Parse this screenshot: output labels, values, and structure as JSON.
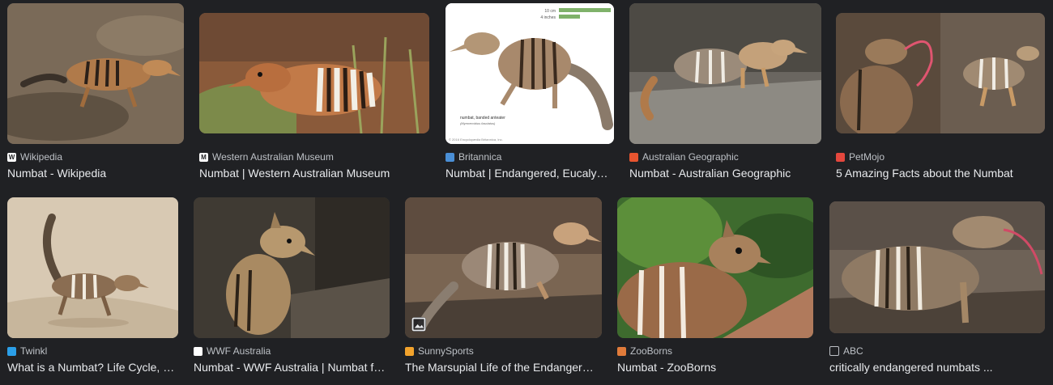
{
  "results": [
    {
      "source": "Wikipedia",
      "title": "Numbat - Wikipedia",
      "favicon": "wikipedia-icon",
      "favicon_color": "#ffffff",
      "favicon_text": "W",
      "favicon_text_color": "#202124"
    },
    {
      "source": "Western Australian Museum",
      "title": "Numbat | Western Australian Museum",
      "favicon": "museum-icon",
      "favicon_color": "#ffffff",
      "favicon_text": "M",
      "favicon_text_color": "#202124"
    },
    {
      "source": "Britannica",
      "title": "Numbat | Endangered, Eucalyptus, Termites | Britannica",
      "favicon": "britannica-icon",
      "favicon_color": "#4a8fd6",
      "favicon_text": "",
      "favicon_text_color": "#ffffff",
      "image_text": {
        "scale_a": "10 cm",
        "scale_b": "4 inches",
        "caption": "numbat, banded anteater",
        "latin": "(Myrmecobius fasciatus)",
        "copyright": "© 2016 Encyclopædia Britannica, Inc."
      }
    },
    {
      "source": "Australian Geographic",
      "title": "Numbat - Australian Geographic",
      "favicon": "australian-geographic-icon",
      "favicon_color": "#e8542f",
      "favicon_text": "",
      "favicon_text_color": "#ffffff"
    },
    {
      "source": "PetMojo",
      "title": "5 Amazing Facts about the Numbat",
      "favicon": "petmojo-icon",
      "favicon_color": "#e4473d",
      "favicon_text": "",
      "favicon_text_color": "#ffffff"
    },
    {
      "source": "Twinkl",
      "title": "What is a Numbat? Life Cycle, Habitat & Facts | Twinkl",
      "favicon": "twinkl-icon",
      "favicon_color": "#2b9fe8",
      "favicon_text": "",
      "favicon_text_color": "#ffffff"
    },
    {
      "source": "WWF Australia",
      "title": "Numbat - WWF Australia | Numbat facts",
      "favicon": "wwf-icon",
      "favicon_color": "#ffffff",
      "favicon_text": "",
      "favicon_text_color": "#202124"
    },
    {
      "source": "SunnySports",
      "title": "The Marsupial Life of the Endangered Numbat",
      "favicon": "sunnysports-icon",
      "favicon_color": "#f2a32c",
      "favicon_text": "",
      "favicon_text_color": "#ffffff"
    },
    {
      "source": "ZooBorns",
      "title": "Numbat - ZooBorns",
      "favicon": "zooborns-icon",
      "favicon_color": "#e07b3a",
      "favicon_text": "",
      "favicon_text_color": "#ffffff"
    },
    {
      "source": "ABC",
      "title": "critically endangered numbats ...",
      "favicon": "abc-icon",
      "favicon_color": "#202124",
      "favicon_text": "",
      "favicon_text_color": "#ffffff"
    }
  ]
}
